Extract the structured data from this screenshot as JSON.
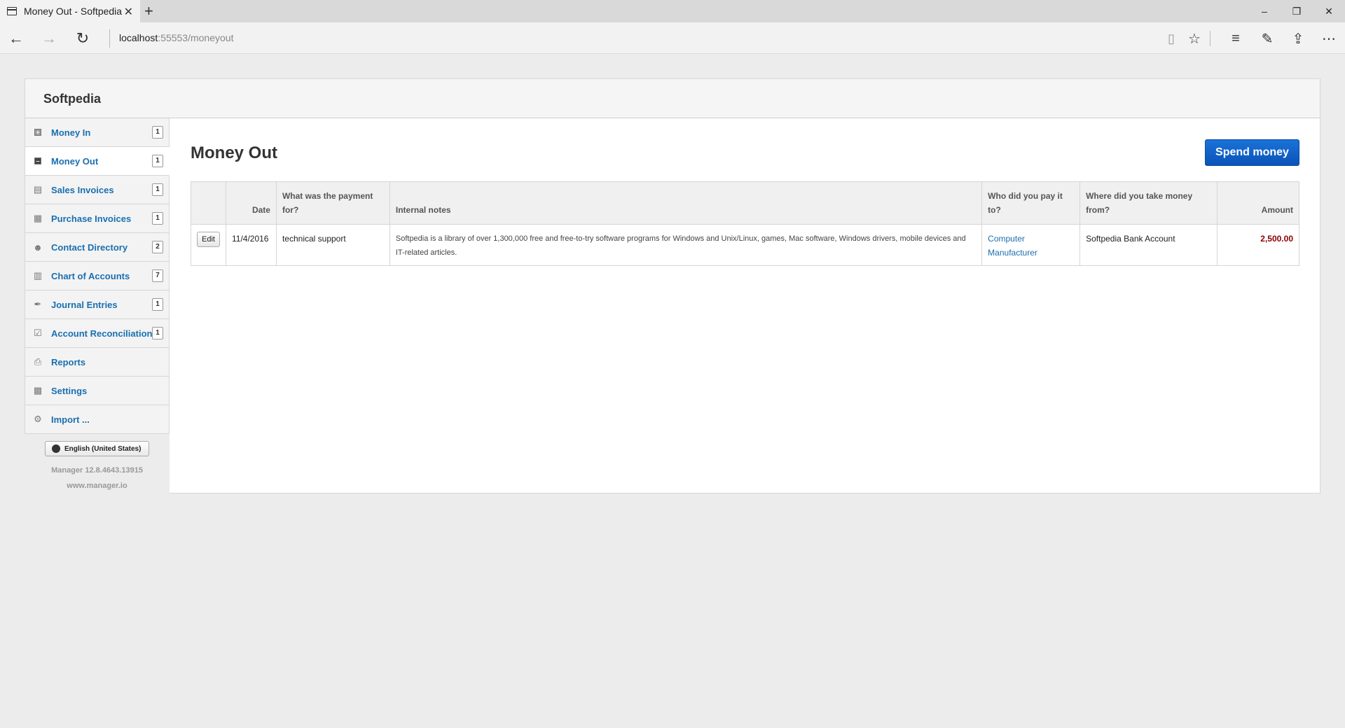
{
  "browser": {
    "tab_title": "Money Out - Softpedia",
    "tab_close": "✕",
    "new_tab": "+",
    "url_host": "localhost",
    "url_rest": ":55553/moneyout",
    "window_controls": [
      "–",
      "❐",
      "✕"
    ]
  },
  "app": {
    "title": "Softpedia"
  },
  "sidebar": {
    "items": [
      {
        "label": "Money In",
        "count": "1",
        "icon": "plus-square-icon"
      },
      {
        "label": "Money Out",
        "count": "1",
        "icon": "minus-square-icon"
      },
      {
        "label": "Sales Invoices",
        "count": "1",
        "icon": "register-icon"
      },
      {
        "label": "Purchase Invoices",
        "count": "1",
        "icon": "calendar-icon"
      },
      {
        "label": "Contact Directory",
        "count": "2",
        "icon": "people-icon"
      },
      {
        "label": "Chart of Accounts",
        "count": "7",
        "icon": "book-icon"
      },
      {
        "label": "Journal Entries",
        "count": "1",
        "icon": "quill-icon"
      },
      {
        "label": "Account Reconciliation",
        "count": "1",
        "icon": "checkbox-icon"
      },
      {
        "label": "Reports",
        "count": "",
        "icon": "printer-icon"
      },
      {
        "label": "Settings",
        "count": "",
        "icon": "settings-icon"
      },
      {
        "label": "Import ...",
        "count": "",
        "icon": "import-icon"
      }
    ],
    "language_button": "English (United States)",
    "version": "Manager 12.8.4643.13915",
    "site": "www.manager.io"
  },
  "main": {
    "page_title": "Money Out",
    "spend_button": "Spend money",
    "columns": {
      "date": "Date",
      "payment_for": "What was the payment for?",
      "notes": "Internal notes",
      "payee": "Who did you pay it to?",
      "account": "Where did you take money from?",
      "amount": "Amount"
    },
    "rows": [
      {
        "edit": "Edit",
        "date": "11/4/2016",
        "payment_for": "technical support",
        "notes": "Softpedia is a library of over 1,300,000 free and free-to-try software programs for Windows and Unix/Linux, games, Mac software, Windows drivers, mobile devices and IT-related articles.",
        "payee": "Computer Manufacturer",
        "account": "Softpedia Bank Account",
        "amount": "2,500.00"
      }
    ]
  }
}
